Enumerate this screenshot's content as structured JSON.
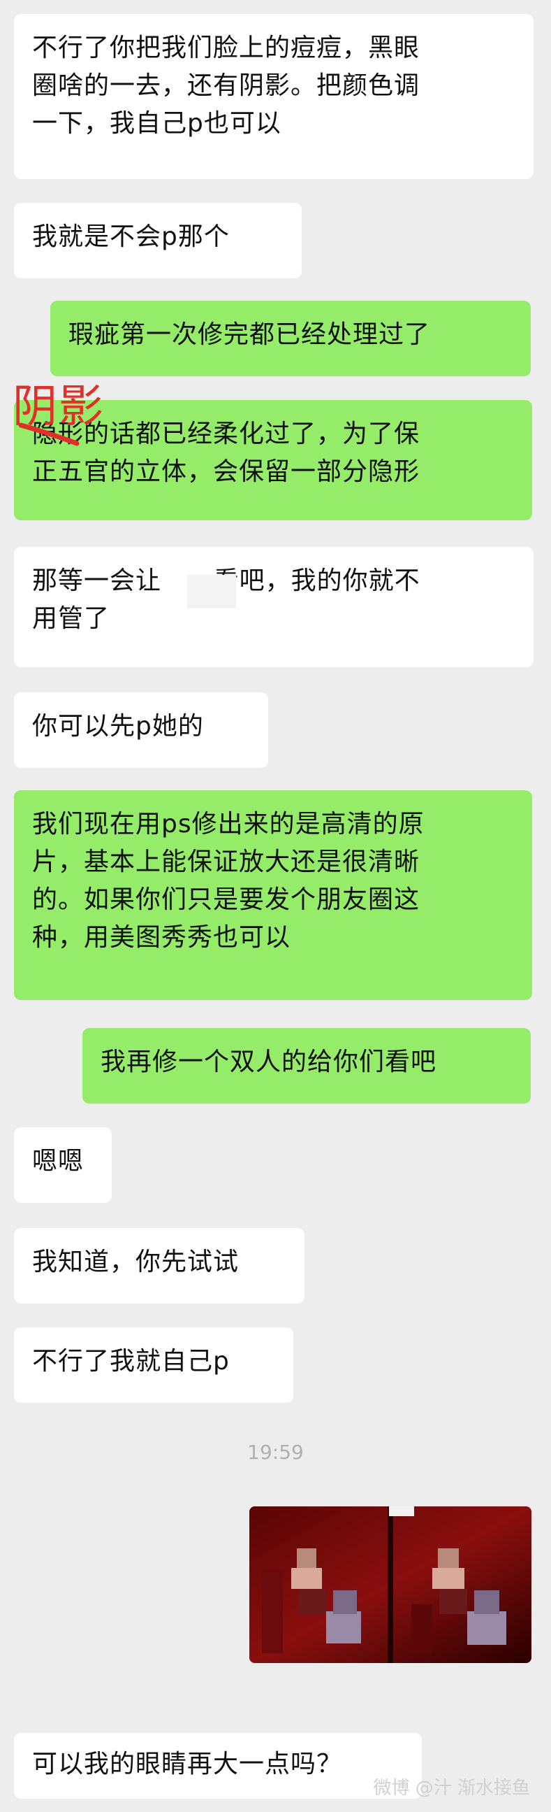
{
  "messages": [
    {
      "side": "in",
      "text": "不行了你把我们脸上的痘痘，黑眼\n圈啥的一去，还有阴影。把颜色调\n一下，我自己p也可以"
    },
    {
      "side": "in",
      "text": "我就是不会p那个"
    },
    {
      "side": "out",
      "text": "瑕疵第一次修完都已经处理过了"
    },
    {
      "side": "out",
      "text": "隐形的话都已经柔化过了，为了保\n正五官的立体，会保留一部分隐形"
    },
    {
      "side": "in",
      "text": "那等一会让      看吧，我的你就不\n用管了"
    },
    {
      "side": "in",
      "text": "你可以先p她的"
    },
    {
      "side": "out",
      "text": "我们现在用ps修出来的是高清的原\n片，基本上能保证放大还是很清晰\n的。如果你们只是要发个朋友圈这\n种，用美图秀秀也可以"
    },
    {
      "side": "out",
      "text": "我再修一个双人的给你们看吧"
    },
    {
      "side": "in",
      "text": "嗯嗯"
    },
    {
      "side": "in",
      "text": "我知道，你先试试"
    },
    {
      "side": "in",
      "text": "不行了我就自己p"
    },
    {
      "side": "in",
      "text": "可以我的眼睛再大一点吗？"
    }
  ],
  "timestamp": "19:59",
  "annotation": "阴影",
  "watermark": "微博 @汁 渐水接鱼",
  "colors": {
    "incoming": "#ffffff",
    "outgoing": "#95ec69",
    "background": "#ededed",
    "annotation": "#e0302a"
  }
}
